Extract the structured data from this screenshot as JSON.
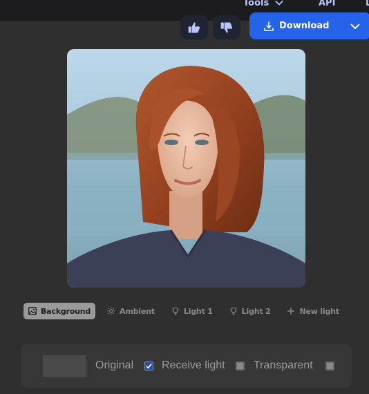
{
  "nav": {
    "tools_label": "Tools",
    "api_label": "API",
    "more_label": "L"
  },
  "actions": {
    "download_label": "Download",
    "accent_color": "#2563eb"
  },
  "image": {
    "subject": "portrait-photo"
  },
  "tabs": [
    {
      "label": "Background",
      "icon": "image-icon",
      "active": true
    },
    {
      "label": "Ambient",
      "icon": "sun-icon",
      "active": false
    },
    {
      "label": "Light 1",
      "icon": "bulb-icon",
      "active": false
    },
    {
      "label": "Light 2",
      "icon": "bulb-icon",
      "active": false
    },
    {
      "label": "New light",
      "icon": "plus-icon",
      "active": false
    }
  ],
  "background_options": {
    "original_label": "Original",
    "original_checked": true,
    "receive_light_label": "Receive light",
    "receive_light_checked": false,
    "transparent_label": "Transparent",
    "transparent_checked": false
  }
}
